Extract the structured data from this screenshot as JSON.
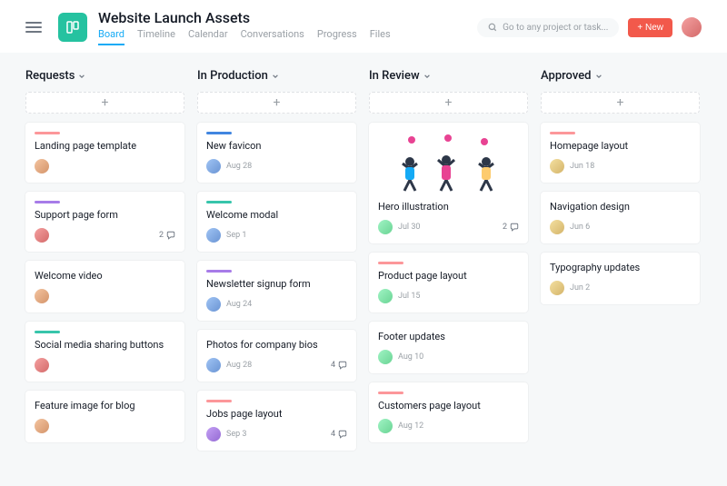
{
  "header": {
    "project_title": "Website Launch Assets",
    "tabs": [
      "Board",
      "Timeline",
      "Calendar",
      "Conversations",
      "Progress",
      "Files"
    ],
    "active_tab": "Board",
    "search_placeholder": "Go to any project or task...",
    "new_button": "+ New"
  },
  "colors": {
    "pink": "#fc979a",
    "purple": "#a77ce8",
    "teal": "#37c5ab",
    "blue": "#4186e0",
    "orange": "#fd9a00"
  },
  "columns": [
    {
      "name": "Requests",
      "cards": [
        {
          "title": "Landing page template",
          "stripe": "pink",
          "assignee": "av1",
          "date": ""
        },
        {
          "title": "Support page form",
          "stripe": "purple",
          "assignee": "av2",
          "date": "",
          "comments": 2
        },
        {
          "title": "Welcome video",
          "stripe": "",
          "assignee": "av1",
          "date": ""
        },
        {
          "title": "Social media sharing buttons",
          "stripe": "teal",
          "assignee": "av2",
          "date": ""
        },
        {
          "title": "Feature image for blog",
          "stripe": "",
          "assignee": "av1",
          "date": ""
        }
      ]
    },
    {
      "name": "In Production",
      "cards": [
        {
          "title": "New favicon",
          "stripe": "blue",
          "assignee": "av3",
          "date": "Aug 28"
        },
        {
          "title": "Welcome modal",
          "stripe": "teal",
          "assignee": "av3",
          "date": "Sep 1"
        },
        {
          "title": "Newsletter signup form",
          "stripe": "purple",
          "assignee": "av3",
          "date": "Aug 24"
        },
        {
          "title": "Photos for company bios",
          "stripe": "",
          "assignee": "av3",
          "date": "Aug 28",
          "comments": 4
        },
        {
          "title": "Jobs page layout",
          "stripe": "pink",
          "assignee": "av4",
          "date": "Sep 3",
          "comments": 4
        }
      ]
    },
    {
      "name": "In Review",
      "cards": [
        {
          "title": "Hero illustration",
          "stripe": "",
          "assignee": "av5",
          "date": "Jul 30",
          "comments": 2,
          "hero": true
        },
        {
          "title": "Product page layout",
          "stripe": "pink",
          "assignee": "av5",
          "date": "Jul 15"
        },
        {
          "title": "Footer updates",
          "stripe": "",
          "assignee": "av5",
          "date": "Aug 10"
        },
        {
          "title": "Customers page layout",
          "stripe": "pink",
          "assignee": "av5",
          "date": "Aug 12"
        }
      ]
    },
    {
      "name": "Approved",
      "cards": [
        {
          "title": "Homepage layout",
          "stripe": "pink",
          "assignee": "av6",
          "date": "Jun 18"
        },
        {
          "title": "Navigation design",
          "stripe": "",
          "assignee": "av6",
          "date": "Jun 6"
        },
        {
          "title": "Typography updates",
          "stripe": "",
          "assignee": "av6",
          "date": "Jun 2"
        }
      ]
    }
  ]
}
